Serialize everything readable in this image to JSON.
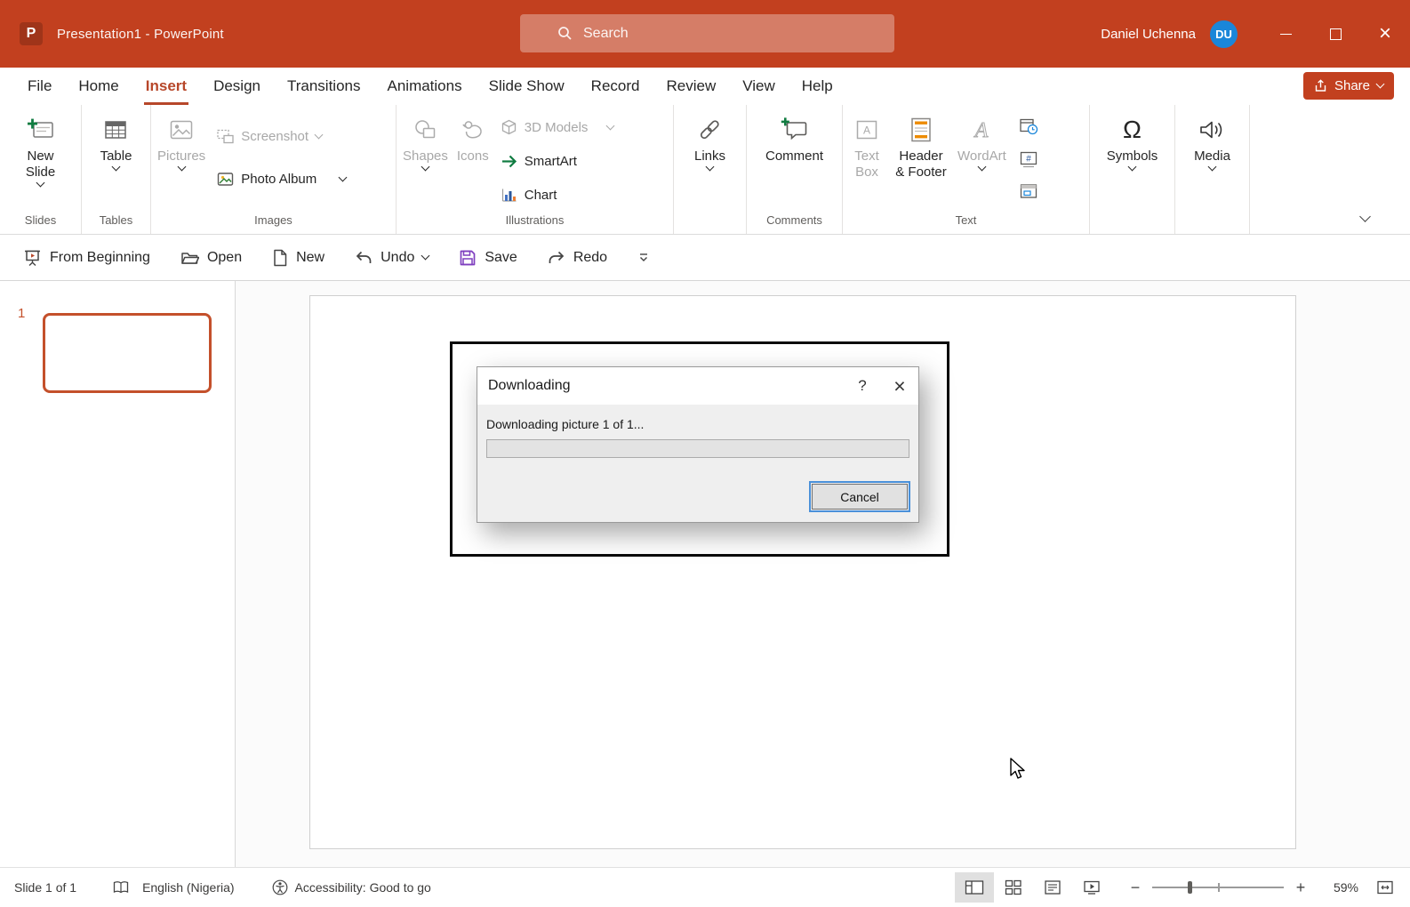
{
  "colors": {
    "titlebar_red": "#C2401F",
    "accent_red": "#B7472A",
    "avatar_blue": "#1A86D9",
    "focus_blue": "#4A90D9",
    "save_purple": "#7F3FBF",
    "plus_green": "#107C41",
    "selected_thumbnail_border": "#C4502B"
  },
  "icons": {
    "omega_glyph": "Ω",
    "help_glyph": "?",
    "close_glyph": "×",
    "zoom_out_glyph": "−",
    "zoom_in_glyph": "+"
  },
  "titlebar": {
    "title": "Presentation1  -  PowerPoint",
    "search_placeholder": "Search",
    "user_name": "Daniel Uchenna",
    "user_initials": "DU"
  },
  "menubar": {
    "tabs": [
      "File",
      "Home",
      "Insert",
      "Design",
      "Transitions",
      "Animations",
      "Slide Show",
      "Record",
      "Review",
      "View",
      "Help"
    ],
    "active_tab": "Insert",
    "share_label": "Share"
  },
  "ribbon": {
    "groups": {
      "slides": {
        "label": "Slides",
        "new_slide": "New Slide"
      },
      "tables": {
        "label": "Tables",
        "table": "Table"
      },
      "images": {
        "label": "Images",
        "pictures": "Pictures",
        "screenshot": "Screenshot",
        "photo_album": "Photo Album"
      },
      "illustrations": {
        "label": "Illustrations",
        "shapes": "Shapes",
        "icons": "Icons",
        "models_3d": "3D Models",
        "smartart": "SmartArt",
        "chart": "Chart"
      },
      "links": {
        "links": "Links"
      },
      "comments": {
        "label": "Comments",
        "comment": "Comment"
      },
      "text": {
        "label": "Text",
        "text_box": "Text Box",
        "header_footer": "Header & Footer",
        "wordart": "WordArt"
      },
      "symbols": {
        "symbols": "Symbols"
      },
      "media": {
        "media": "Media"
      }
    }
  },
  "quickbar": {
    "from_beginning": "From Beginning",
    "open": "Open",
    "new": "New",
    "undo": "Undo",
    "save": "Save",
    "redo": "Redo"
  },
  "slides_panel": {
    "slide_number": "1"
  },
  "dialog": {
    "title": "Downloading",
    "message": "Downloading picture 1 of 1...",
    "progress_percent": 0,
    "cancel_label": "Cancel"
  },
  "statusbar": {
    "slide_info": "Slide 1 of 1",
    "language": "English (Nigeria)",
    "accessibility": "Accessibility: Good to go",
    "zoom_percent": "59%"
  }
}
